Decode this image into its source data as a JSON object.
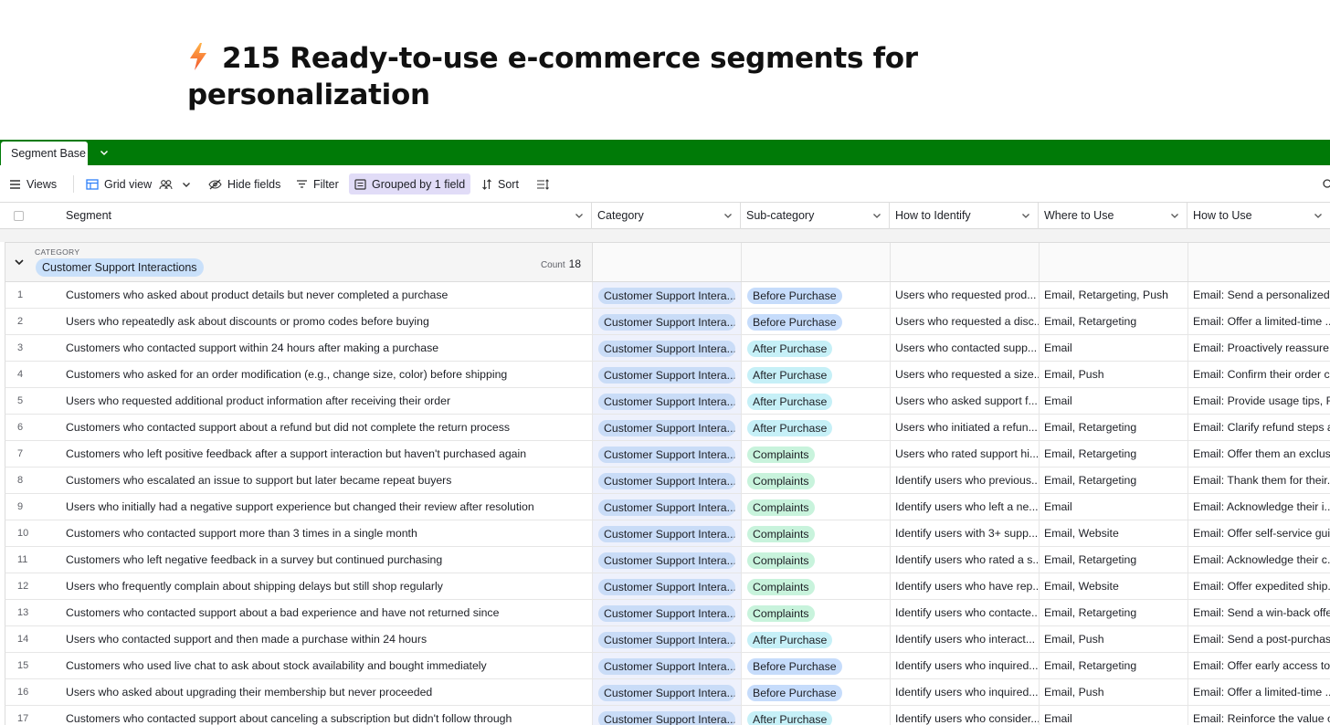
{
  "page": {
    "title_line1": "215 Ready-to-use e-commerce segments for",
    "title_line2": "personalization",
    "title_icon": "lightning-bolt-icon"
  },
  "tabs": {
    "active_label": "Segment Base"
  },
  "toolbar": {
    "views_label": "Views",
    "view_name": "Grid view",
    "hide_fields_label": "Hide fields",
    "filter_label": "Filter",
    "grouped_label": "Grouped by 1 field",
    "sort_label": "Sort"
  },
  "columns": [
    {
      "label": "Segment"
    },
    {
      "label": "Category"
    },
    {
      "label": "Sub-category"
    },
    {
      "label": "How to Identify"
    },
    {
      "label": "Where to Use"
    },
    {
      "label": "How to Use"
    }
  ],
  "group": {
    "field_label": "CATEGORY",
    "value": "Customer Support Interactions",
    "count_label": "Count",
    "count": "18"
  },
  "colors": {
    "topbar": "#007a07",
    "grouped_bg": "#e1dcf7",
    "sub_before": "#c6dcfb",
    "sub_after": "#c6f0f7",
    "sub_complaints": "#c8f3dc"
  },
  "rows": [
    {
      "n": "1",
      "segment": "Customers who asked about product details but never completed a purchase",
      "category": "Customer Support Intera...",
      "sub": "Before Purchase",
      "sub_type": "before",
      "identify": "Users who requested prod...",
      "where": "Email, Retargeting, Push",
      "use": "Email: Send a personalized ..."
    },
    {
      "n": "2",
      "segment": "Users who repeatedly ask about discounts or promo codes before buying",
      "category": "Customer Support Intera...",
      "sub": "Before Purchase",
      "sub_type": "before",
      "identify": "Users who requested a disc...",
      "where": "Email, Retargeting",
      "use": "Email: Offer a limited-time ..."
    },
    {
      "n": "3",
      "segment": "Customers who contacted support within 24 hours after making a purchase",
      "category": "Customer Support Intera...",
      "sub": "After Purchase",
      "sub_type": "after",
      "identify": "Users who contacted supp...",
      "where": "Email",
      "use": "Email: Proactively reassure ..."
    },
    {
      "n": "4",
      "segment": "Customers who asked for an order modification (e.g., change size, color) before shipping",
      "category": "Customer Support Intera...",
      "sub": "After Purchase",
      "sub_type": "after",
      "identify": "Users who requested a size...",
      "where": "Email, Push",
      "use": "Email: Confirm their order c..."
    },
    {
      "n": "5",
      "segment": "Users who requested additional product information after receiving their order",
      "category": "Customer Support Intera...",
      "sub": "After Purchase",
      "sub_type": "after",
      "identify": "Users who asked support f...",
      "where": "Email",
      "use": "Email: Provide usage tips, F..."
    },
    {
      "n": "6",
      "segment": "Customers who contacted support about a refund but did not complete the return process",
      "category": "Customer Support Intera...",
      "sub": "After Purchase",
      "sub_type": "after",
      "identify": "Users who initiated a refun...",
      "where": "Email, Retargeting",
      "use": "Email: Clarify refund steps a..."
    },
    {
      "n": "7",
      "segment": "Customers who left positive feedback after a support interaction but haven't purchased again",
      "category": "Customer Support Intera...",
      "sub": "Complaints",
      "sub_type": "complaints",
      "identify": "Users who rated support hi...",
      "where": "Email, Retargeting",
      "use": "Email: Offer them an exclus..."
    },
    {
      "n": "8",
      "segment": "Customers who escalated an issue to support but later became repeat buyers",
      "category": "Customer Support Intera...",
      "sub": "Complaints",
      "sub_type": "complaints",
      "identify": "Identify users who previous...",
      "where": "Email, Retargeting",
      "use": "Email: Thank them for their..."
    },
    {
      "n": "9",
      "segment": "Users who initially had a negative support experience but changed their review after resolution",
      "category": "Customer Support Intera...",
      "sub": "Complaints",
      "sub_type": "complaints",
      "identify": "Identify users who left a ne...",
      "where": "Email",
      "use": "Email: Acknowledge their i..."
    },
    {
      "n": "10",
      "segment": "Customers who contacted support more than 3 times in a single month",
      "category": "Customer Support Intera...",
      "sub": "Complaints",
      "sub_type": "complaints",
      "identify": "Identify users with 3+ supp...",
      "where": "Email, Website",
      "use": "Email: Offer self-service gui..."
    },
    {
      "n": "11",
      "segment": "Customers who left negative feedback in a survey but continued purchasing",
      "category": "Customer Support Intera...",
      "sub": "Complaints",
      "sub_type": "complaints",
      "identify": "Identify users who rated a s...",
      "where": "Email, Retargeting",
      "use": "Email: Acknowledge their c..."
    },
    {
      "n": "12",
      "segment": "Users who frequently complain about shipping delays but still shop regularly",
      "category": "Customer Support Intera...",
      "sub": "Complaints",
      "sub_type": "complaints",
      "identify": "Identify users who have rep...",
      "where": "Email, Website",
      "use": "Email: Offer expedited ship..."
    },
    {
      "n": "13",
      "segment": "Customers who contacted support about a bad experience and have not returned since",
      "category": "Customer Support Intera...",
      "sub": "Complaints",
      "sub_type": "complaints",
      "identify": "Identify users who contacte...",
      "where": "Email, Retargeting",
      "use": "Email: Send a win-back offe..."
    },
    {
      "n": "14",
      "segment": "Users who contacted support and then made a purchase within 24 hours",
      "category": "Customer Support Intera...",
      "sub": "After Purchase",
      "sub_type": "after",
      "identify": "Identify users who interact...",
      "where": "Email, Push",
      "use": "Email: Send a post-purchas..."
    },
    {
      "n": "15",
      "segment": "Customers who used live chat to ask about stock availability and bought immediately",
      "category": "Customer Support Intera...",
      "sub": "Before Purchase",
      "sub_type": "before",
      "identify": "Identify users who inquired...",
      "where": "Email, Retargeting",
      "use": "Email: Offer early access to ..."
    },
    {
      "n": "16",
      "segment": "Users who asked about upgrading their membership but never proceeded",
      "category": "Customer Support Intera...",
      "sub": "Before Purchase",
      "sub_type": "before",
      "identify": "Identify users who inquired...",
      "where": "Email, Push",
      "use": "Email: Offer a limited-time ..."
    },
    {
      "n": "17",
      "segment": "Customers who contacted support about canceling a subscription but didn't follow through",
      "category": "Customer Support Intera...",
      "sub": "After Purchase",
      "sub_type": "after",
      "identify": "Identify users who consider...",
      "where": "Email",
      "use": "Email: Reinforce the value o..."
    }
  ]
}
